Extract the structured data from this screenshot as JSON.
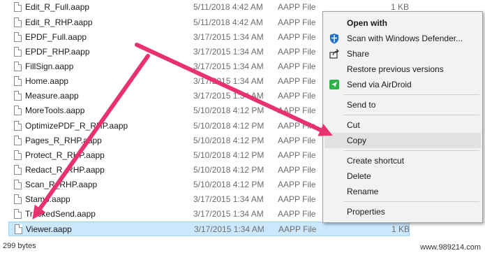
{
  "files": [
    {
      "name": "Edit_R_Full.aapp",
      "date": "5/11/2018 4:42 AM",
      "type": "AAPP File",
      "size": "1 KB"
    },
    {
      "name": "Edit_R_RHP.aapp",
      "date": "5/11/2018 4:42 AM",
      "type": "AAPP File",
      "size": ""
    },
    {
      "name": "EPDF_Full.aapp",
      "date": "3/17/2015 1:34 AM",
      "type": "AAPP File",
      "size": ""
    },
    {
      "name": "EPDF_RHP.aapp",
      "date": "3/17/2015 1:34 AM",
      "type": "AAPP File",
      "size": ""
    },
    {
      "name": "FillSign.aapp",
      "date": "3/17/2015 1:34 AM",
      "type": "AAPP File",
      "size": ""
    },
    {
      "name": "Home.aapp",
      "date": "3/17/2015 1:34 AM",
      "type": "AAPP File",
      "size": ""
    },
    {
      "name": "Measure.aapp",
      "date": "3/17/2015 1:34 AM",
      "type": "AAPP File",
      "size": ""
    },
    {
      "name": "MoreTools.aapp",
      "date": "5/10/2018 4:12 PM",
      "type": "AAPP File",
      "size": ""
    },
    {
      "name": "OptimizePDF_R_RHP.aapp",
      "date": "5/10/2018 4:12 PM",
      "type": "AAPP File",
      "size": ""
    },
    {
      "name": "Pages_R_RHP.aapp",
      "date": "5/10/2018 4:12 PM",
      "type": "AAPP File",
      "size": ""
    },
    {
      "name": "Protect_R_RHP.aapp",
      "date": "5/10/2018 4:12 PM",
      "type": "AAPP File",
      "size": ""
    },
    {
      "name": "Redact_R_RHP.aapp",
      "date": "5/10/2018 4:12 PM",
      "type": "AAPP File",
      "size": ""
    },
    {
      "name": "Scan_R_RHP.aapp",
      "date": "5/10/2018 4:12 PM",
      "type": "AAPP File",
      "size": ""
    },
    {
      "name": "Stamp.aapp",
      "date": "3/17/2015 1:34 AM",
      "type": "AAPP File",
      "size": ""
    },
    {
      "name": "TrackedSend.aapp",
      "date": "3/17/2015 1:34 AM",
      "type": "AAPP File",
      "size": ""
    },
    {
      "name": "Viewer.aapp",
      "date": "3/17/2015 1:34 AM",
      "type": "AAPP File",
      "size": "1 KB"
    }
  ],
  "status_bar": {
    "text": "299 bytes"
  },
  "context_menu": {
    "open_with": "Open with",
    "scan_defender": "Scan with Windows Defender...",
    "share": "Share",
    "restore_versions": "Restore previous versions",
    "send_airdroid": "Send via AirDroid",
    "send_to": "Send to",
    "cut": "Cut",
    "copy": "Copy",
    "create_shortcut": "Create shortcut",
    "delete": "Delete",
    "rename": "Rename",
    "properties": "Properties"
  },
  "accent_colors": {
    "selection": "#cce8ff",
    "arrow": "#e8326e",
    "defender": "#1f6fc5",
    "airdroid": "#2db34a"
  },
  "watermark": "www.989214.com"
}
